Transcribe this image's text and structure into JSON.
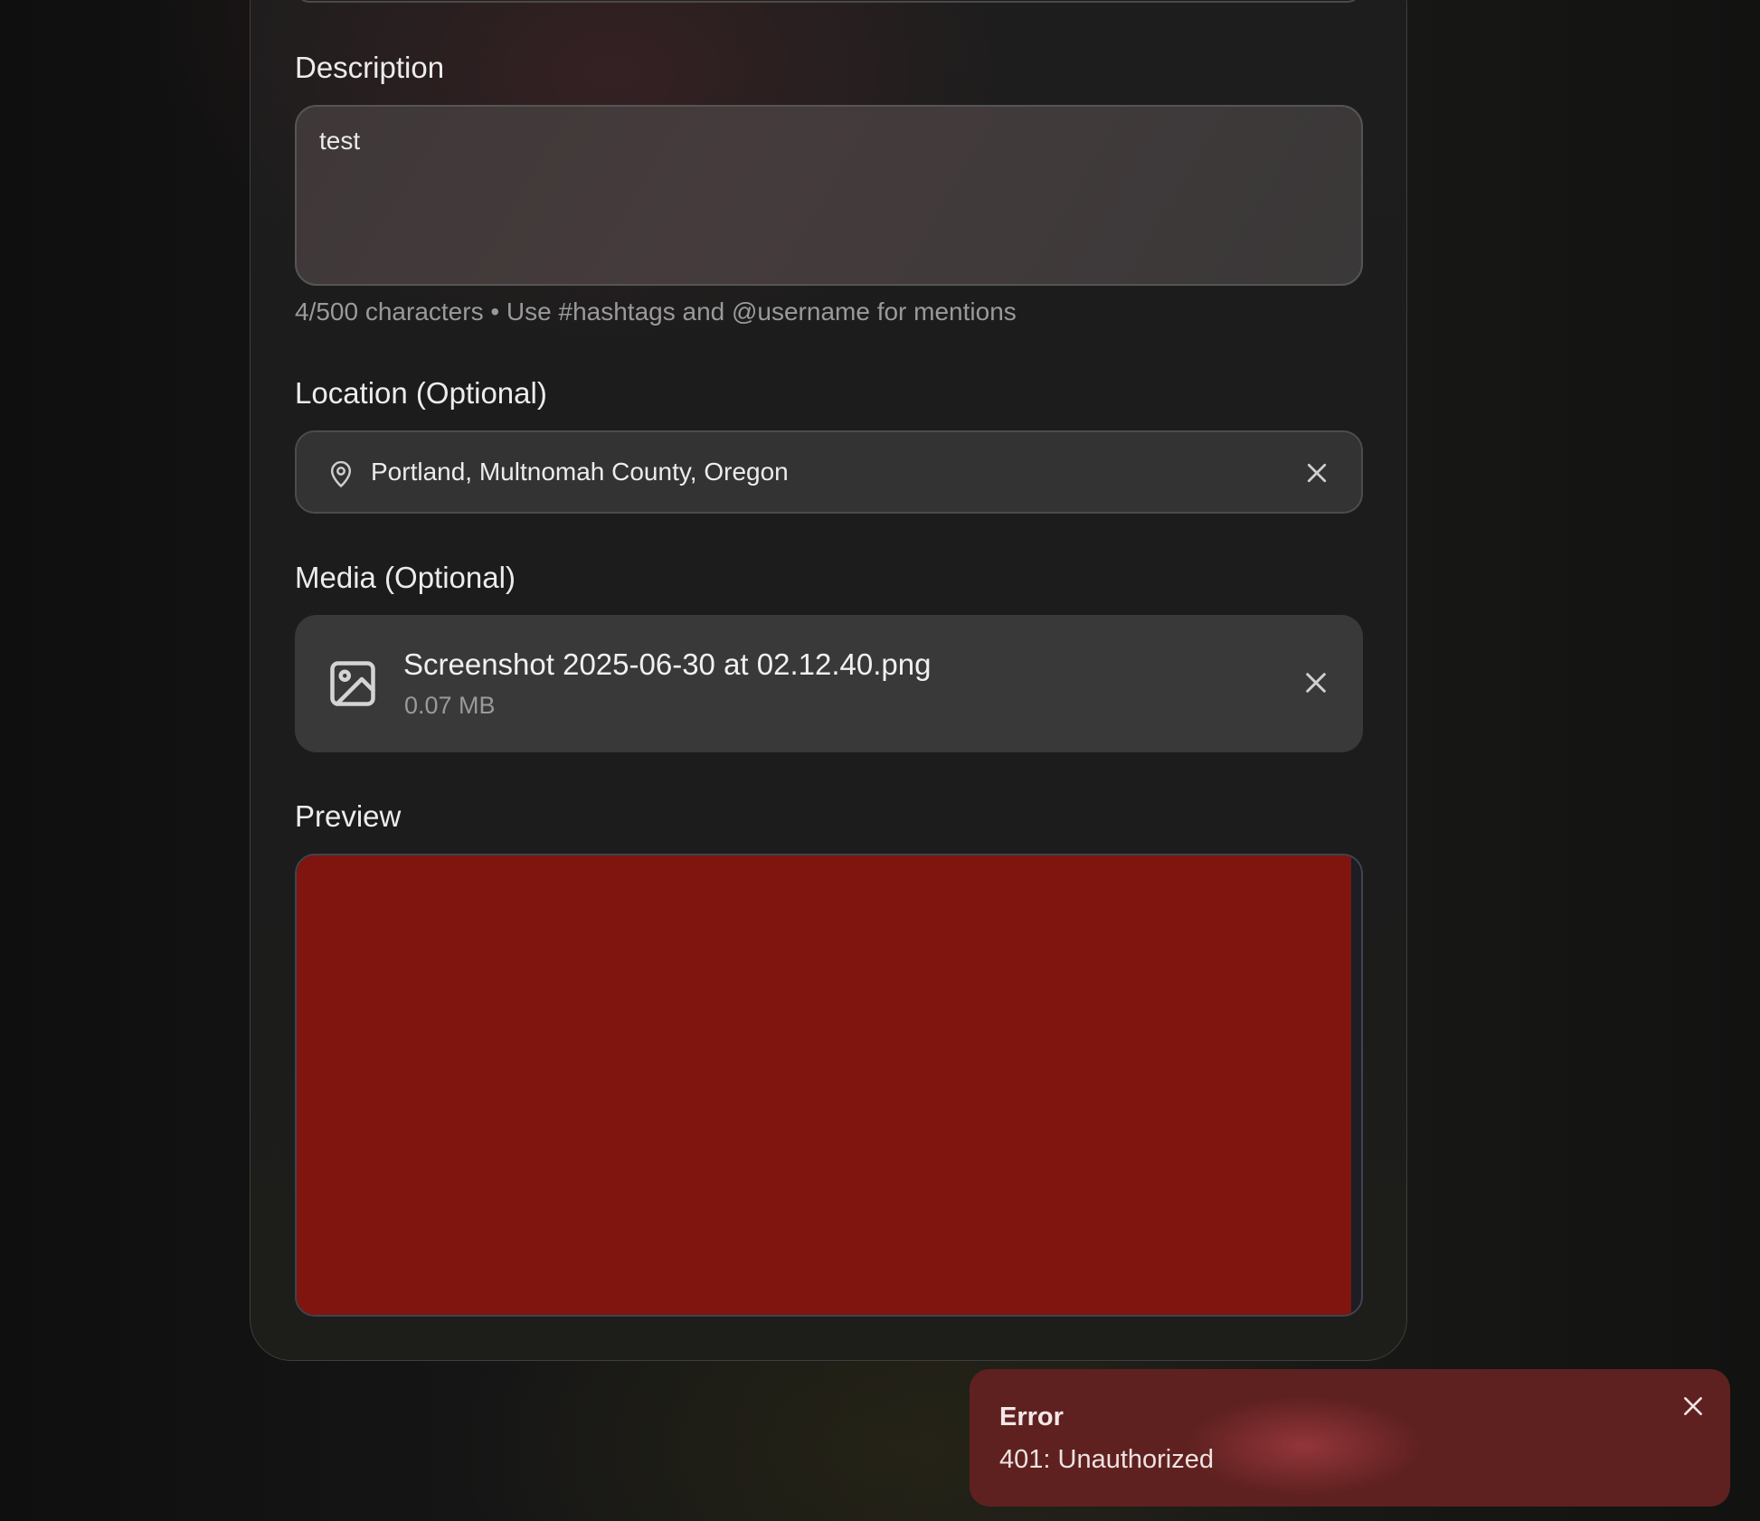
{
  "form": {
    "description": {
      "label": "Description",
      "value": "test",
      "helper": "4/500 characters • Use #hashtags and @username for mentions"
    },
    "location": {
      "label": "Location (Optional)",
      "value": "Portland, Multnomah County, Oregon",
      "icon": "map-pin-icon",
      "clear_icon": "close-icon"
    },
    "media": {
      "label": "Media (Optional)",
      "file_name": "Screenshot 2025-06-30 at 02.12.40.png",
      "file_size": "0.07 MB",
      "icon": "image-icon",
      "remove_icon": "close-icon"
    },
    "preview": {
      "label": "Preview",
      "image_color": "#7f150e"
    }
  },
  "toast": {
    "title": "Error",
    "message": "401: Unauthorized",
    "close_icon": "close-icon",
    "background": "#5f2120"
  }
}
